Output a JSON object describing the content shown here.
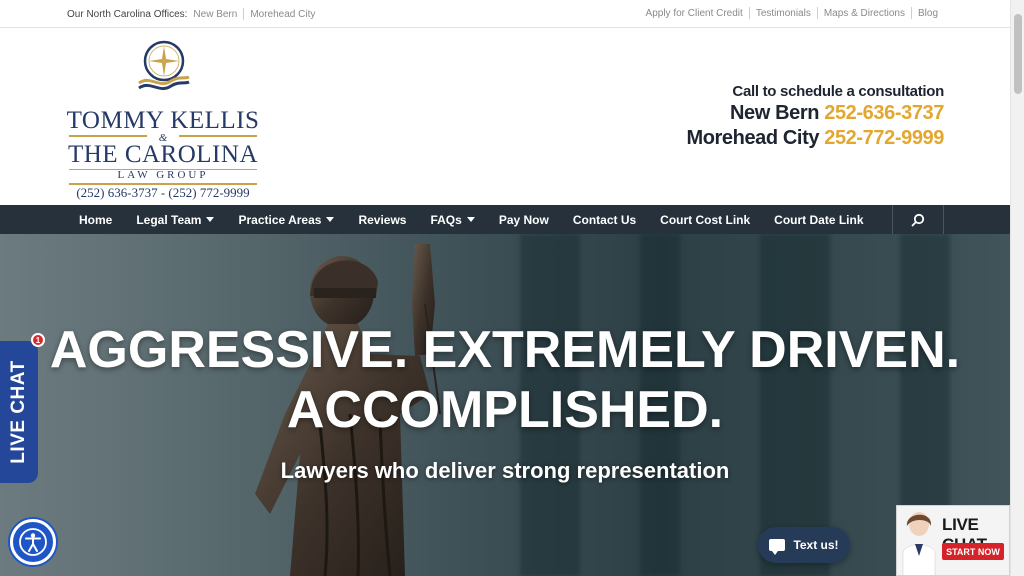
{
  "topbar": {
    "offices_label": "Our North Carolina Offices:",
    "offices": [
      "New Bern",
      "Morehead City"
    ],
    "links": [
      "Apply for Client Credit",
      "Testimonials",
      "Maps & Directions",
      "Blog"
    ]
  },
  "logo": {
    "line1": "TOMMY KELLIS",
    "amp": "&",
    "line2": "THE CAROLINA",
    "line3": "LAW GROUP",
    "phones": "(252) 636-3737 - (252) 772-9999"
  },
  "contact": {
    "cta": "Call to schedule a consultation",
    "rows": [
      {
        "city": "New Bern",
        "phone": "252-636-3737"
      },
      {
        "city": "Morehead City",
        "phone": "252-772-9999"
      }
    ],
    "accent_color": "#e3a72f"
  },
  "nav": {
    "items": [
      {
        "label": "Home",
        "dropdown": false
      },
      {
        "label": "Legal Team",
        "dropdown": true
      },
      {
        "label": "Practice Areas",
        "dropdown": true
      },
      {
        "label": "Reviews",
        "dropdown": false
      },
      {
        "label": "FAQs",
        "dropdown": true
      },
      {
        "label": "Pay Now",
        "dropdown": false
      },
      {
        "label": "Contact Us",
        "dropdown": false
      },
      {
        "label": "Court Cost Link",
        "dropdown": false
      },
      {
        "label": "Court Date Link",
        "dropdown": false
      }
    ],
    "search_icon": "search-icon",
    "background": "#26313c"
  },
  "hero": {
    "headline_line1": "AGGRESSIVE. EXTREMELY DRIVEN.",
    "headline_line2": "ACCOMPLISHED.",
    "subheadline": "Lawyers who deliver strong representation"
  },
  "widgets": {
    "live_chat_tab": "LIVE CHAT",
    "chat_badge_count": "1",
    "text_us": "Text us!",
    "live_chat_title": "LIVE CHAT",
    "start_now": "START NOW",
    "accessibility_icon": "accessibility-icon"
  }
}
